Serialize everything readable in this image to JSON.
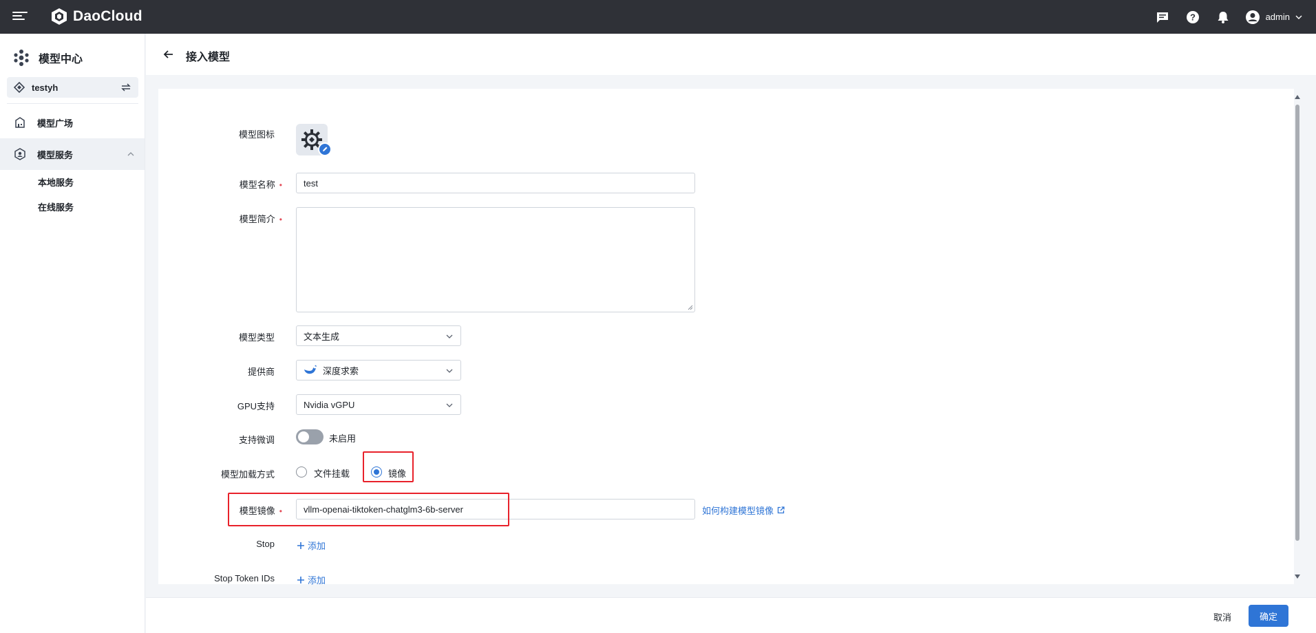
{
  "app": {
    "brand": "DaoCloud",
    "user": "admin"
  },
  "sidebar": {
    "title": "模型中心",
    "workspace": "testyh",
    "items": [
      {
        "label": "模型广场"
      },
      {
        "label": "模型服务"
      }
    ],
    "sub_items": [
      {
        "label": "本地服务"
      },
      {
        "label": "在线服务"
      }
    ]
  },
  "page": {
    "title": "接入模型"
  },
  "form": {
    "icon_label": "模型图标",
    "name_label": "模型名称",
    "name_value": "test",
    "intro_label": "模型简介",
    "type_label": "模型类型",
    "type_value": "文本生成",
    "provider_label": "提供商",
    "provider_value": "深度求索",
    "gpu_label": "GPU支持",
    "gpu_value": "Nvidia vGPU",
    "finetune_label": "支持微调",
    "finetune_status": "未启用",
    "finetune_enabled": false,
    "load_label": "模型加载方式",
    "load_options": [
      {
        "label": "文件挂载",
        "checked": false
      },
      {
        "label": "镜像",
        "checked": true
      }
    ],
    "image_label": "模型镜像",
    "image_value": "vllm-openai-tiktoken-chatglm3-6b-server",
    "image_help_link": "如何构建模型镜像",
    "stop_label": "Stop",
    "stop_add": "添加",
    "stop_token_label": "Stop Token IDs",
    "stop_token_add": "添加"
  },
  "footer": {
    "cancel": "取消",
    "ok": "确定"
  },
  "colors": {
    "accent": "#2f75d6",
    "topbar": "#2f3137",
    "highlight": "#e8212a"
  }
}
